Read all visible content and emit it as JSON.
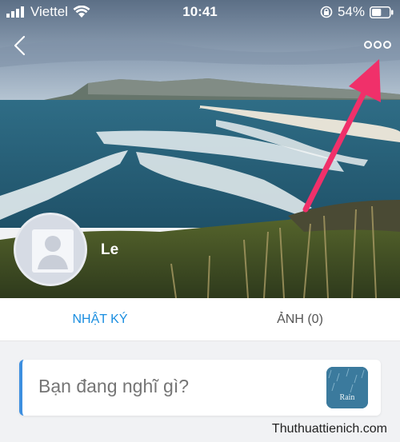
{
  "status_bar": {
    "carrier": "Viettel",
    "time": "10:41",
    "battery_percent": "54%",
    "battery_level": 0.54,
    "icons": [
      "signal-icon",
      "wifi-icon",
      "orientation-lock-icon",
      "battery-icon"
    ]
  },
  "header": {
    "back_icon": "chevron-left-icon",
    "more_icon": "more-dots-icon"
  },
  "profile": {
    "name": "Le",
    "avatar_icon": "default-avatar-icon"
  },
  "tabs": [
    {
      "label": "NHẬT KÝ",
      "active": true
    },
    {
      "label": "ẢNH (0)",
      "active": false
    }
  ],
  "composer": {
    "placeholder": "Bạn đang nghĩ gì?",
    "thumbnail_label": "Rain"
  },
  "watermark": "Thuthuattienich.com",
  "colors": {
    "accent": "#1a8ee0",
    "annotation_arrow": "#f0306a",
    "composer_border": "#3d8fe0"
  }
}
